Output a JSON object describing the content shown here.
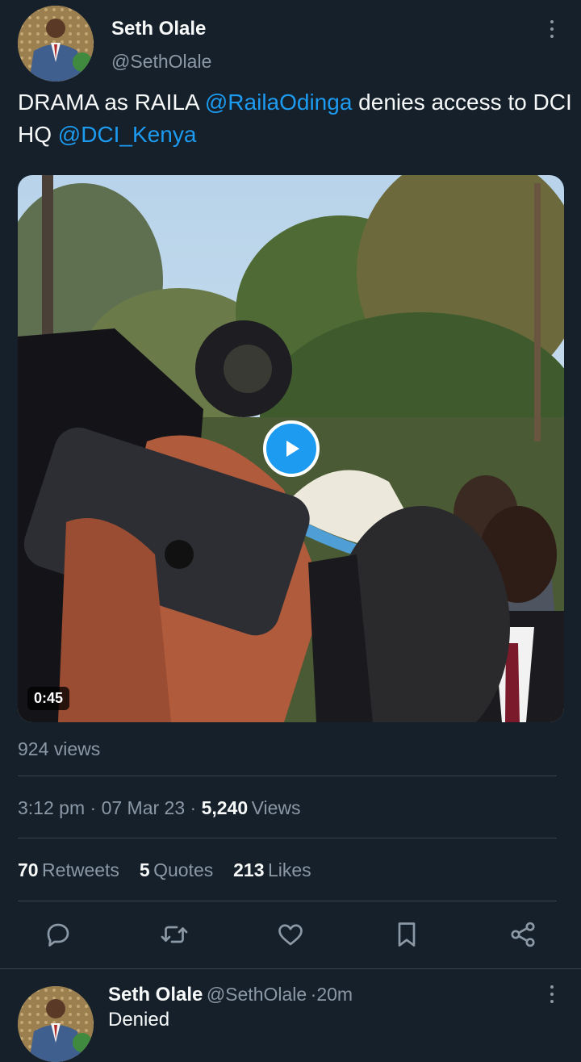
{
  "author": {
    "name": "Seth Olale",
    "handle": "@SethOlale"
  },
  "tweet": {
    "text_part1": "DRAMA as RAILA ",
    "mention1": "@RailaOdinga",
    "text_part2": " denies access to DCI HQ ",
    "mention2": "@DCI_Kenya"
  },
  "media": {
    "duration": "0:45",
    "views": "924 views"
  },
  "meta": {
    "time": "3:12 pm",
    "sep1": " · ",
    "date": "07 Mar 23",
    "sep2": " · ",
    "views_count": "5,240",
    "views_label": "Views"
  },
  "stats": {
    "retweets_count": "70",
    "retweets_label": "Retweets",
    "quotes_count": "5",
    "quotes_label": "Quotes",
    "likes_count": "213",
    "likes_label": "Likes"
  },
  "actions": [
    "reply-icon",
    "retweet-icon",
    "like-icon",
    "bookmark-icon",
    "share-icon"
  ],
  "reply": {
    "name": "Seth Olale",
    "handle": "@SethOlale",
    "dot": "·",
    "time": "20m",
    "text": "Denied"
  },
  "colors": {
    "background": "#15202b",
    "accent": "#1d9bf0",
    "muted": "#8b98a5"
  }
}
